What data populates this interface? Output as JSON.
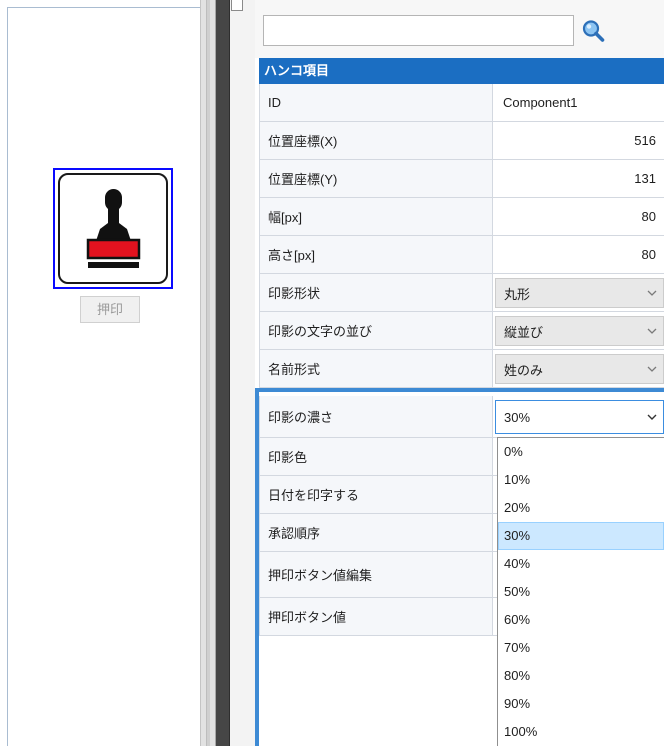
{
  "canvas": {
    "stamp_icon": "stamp-icon",
    "stamp_label": "押印"
  },
  "panel": {
    "search": {
      "value": "",
      "icon": "search-icon"
    },
    "section_title": "ハンコ項目",
    "properties": [
      {
        "label": "ID",
        "value": "Component1"
      },
      {
        "label": "位置座標(X)",
        "value": "516"
      },
      {
        "label": "位置座標(Y)",
        "value": "131"
      },
      {
        "label": "幅[px]",
        "value": "80"
      },
      {
        "label": "高さ[px]",
        "value": "80"
      },
      {
        "label": "印影形状",
        "value": "丸形",
        "dropdown": true
      },
      {
        "label": "印影の文字の並び",
        "value": "縦並び",
        "dropdown": true
      },
      {
        "label": "名前形式",
        "value": "姓のみ",
        "dropdown": true
      },
      {
        "label": "印影の濃さ",
        "value": "30%",
        "dropdown": true,
        "expanded": true
      },
      {
        "label": "印影色"
      },
      {
        "label": "日付を印字する"
      },
      {
        "label": "承認順序"
      },
      {
        "label": "押印ボタン値編集"
      },
      {
        "label": "押印ボタン値"
      }
    ],
    "density_options": [
      "0%",
      "10%",
      "20%",
      "30%",
      "40%",
      "50%",
      "60%",
      "70%",
      "80%",
      "90%",
      "100%"
    ],
    "density_highlighted_index": 3,
    "chevron_icon": "chevron-down-icon"
  },
  "colors": {
    "section_header": "#1b6ec2",
    "selection_border": "#0a0aff",
    "highlight_frame": "#3d8ad4",
    "highlighted_option": "#cce8ff",
    "stamp_red": "#e3121f",
    "stamp_black": "#111111"
  }
}
